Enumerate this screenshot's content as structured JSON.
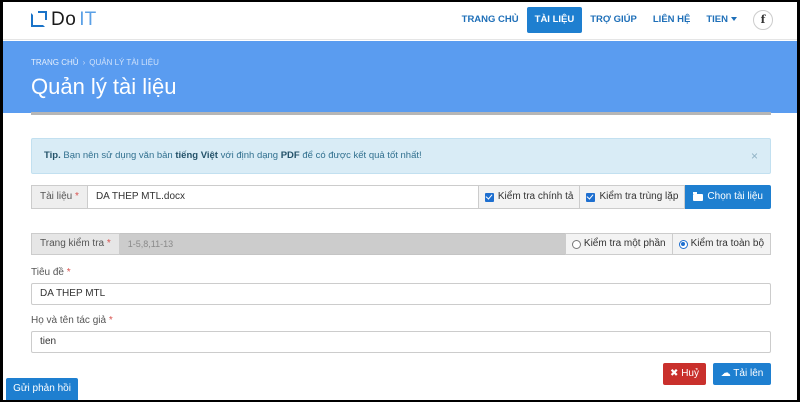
{
  "brand": {
    "do": "Do",
    "it": "IT"
  },
  "nav": {
    "items": [
      {
        "label": "TRANG CHỦ",
        "active": false
      },
      {
        "label": "TÀI LIỆU",
        "active": true
      },
      {
        "label": "TRỢ GIÚP",
        "active": false
      },
      {
        "label": "LIÊN HỆ",
        "active": false
      }
    ],
    "user": "TIEN",
    "facebook": "f"
  },
  "header": {
    "breadcrumb": [
      "TRANG CHỦ",
      "QUẢN LÝ TÀI LIỆU"
    ],
    "title": "Quản lý tài liệu"
  },
  "tip": {
    "label": "Tip.",
    "text_1": "Bạn nên sử dụng văn bản",
    "bold_1": "tiếng Việt",
    "text_2": "với định dạng",
    "bold_2": "PDF",
    "text_3": "để có được kết quả tốt nhất!",
    "close": "×"
  },
  "document": {
    "label": "Tài liệu",
    "required": "*",
    "value": "DA THEP MTL.docx",
    "check_spelling": "Kiểm tra chính tả",
    "check_duplicate": "Kiểm tra trùng lặp",
    "choose_button": "Chọn tài liệu"
  },
  "pages": {
    "label": "Trang kiểm tra",
    "required": "*",
    "placeholder": "1-5,8,11-13",
    "partial": "Kiểm tra một phần",
    "full": "Kiểm tra toàn bộ",
    "selected": "full"
  },
  "title_field": {
    "label": "Tiêu đề",
    "required": "*",
    "value": "DA THEP MTL"
  },
  "author_field": {
    "label": "Họ và tên tác giả",
    "required": "*",
    "value": "tien"
  },
  "actions": {
    "cancel": "Huỷ",
    "upload": "Tải lên"
  },
  "feedback": "Gửi phản hồi",
  "colors": {
    "primary": "#1e7fd0",
    "header": "#5a9cf0",
    "danger": "#c9302c",
    "tip_bg": "#d9ecf6"
  }
}
